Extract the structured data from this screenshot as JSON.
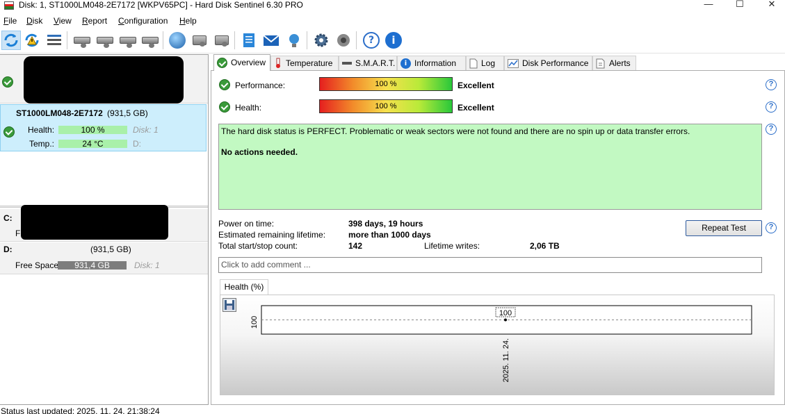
{
  "titlebar": {
    "title": "Disk: 1, ST1000LM048-2E7172 [WKPV65PC]  -  Hard Disk Sentinel 6.30 PRO",
    "minimize": "—",
    "maximize": "☐",
    "close": "✕"
  },
  "menu": [
    "File",
    "Disk",
    "View",
    "Report",
    "Configuration",
    "Help"
  ],
  "toolbar_icons": [
    "refresh-icon",
    "refresh-warning-icon",
    "disk-list-icon",
    "disk-icon",
    "disk-clock-icon",
    "disk-check-icon",
    "disk-search-icon",
    "globe-icon",
    "network-drive-icon",
    "remote-disk-icon",
    "notepad-icon",
    "mail-icon",
    "network-icon",
    "gear-icon",
    "speaker-icon",
    "help-icon",
    "info-icon"
  ],
  "disk": {
    "name": "ST1000LM048-2E7172",
    "size": "(931,5 GB)",
    "health_label": "Health:",
    "health_value": "100 %",
    "health_fill": 1.0,
    "disk_ref": "Disk: 1",
    "temp_label": "Temp.:",
    "temp_value": "24 °C",
    "drive_ref": "D:"
  },
  "partitions": [
    {
      "letter": "C:",
      "free_label": "Free"
    },
    {
      "letter": "D:",
      "size": "(931,5 GB)",
      "free_label": "Free Space",
      "free_value": "931,4 GB",
      "disk_ref": "Disk: 1"
    }
  ],
  "tabs": [
    "Overview",
    "Temperature",
    "S.M.A.R.T.",
    "Information",
    "Log",
    "Disk Performance",
    "Alerts"
  ],
  "overview": {
    "performance_label": "Performance:",
    "performance_value": "100 %",
    "performance_rating": "Excellent",
    "health_label": "Health:",
    "health_value": "100 %",
    "health_rating": "Excellent",
    "status_text": "The hard disk status is PERFECT. Problematic or weak sectors were not found and there are no spin up or data transfer errors.",
    "action_text": "No actions needed.",
    "power_on_label": "Power on time:",
    "power_on_value": "398 days, 19 hours",
    "lifetime_label": "Estimated remaining lifetime:",
    "lifetime_value": "more than 1000 days",
    "startstop_label": "Total start/stop count:",
    "startstop_value": "142",
    "writes_label": "Lifetime writes:",
    "writes_value": "2,06 TB",
    "repeat_button": "Repeat Test",
    "comment_placeholder": "Click to add comment ..."
  },
  "chart_tab": "Health (%)",
  "chart_data": {
    "type": "line",
    "x": [
      "2025. 11. 24."
    ],
    "series": [
      {
        "values": [
          100
        ]
      }
    ],
    "point_labels": [
      "100"
    ],
    "ytick_labels": [
      "100"
    ],
    "xtick_labels": [
      "2025. 11. 24."
    ],
    "grid": true
  },
  "status_bar": "Status last updated: 2025. 11. 24. 21:38:24",
  "colors": {
    "good_green": "#a9f0a9",
    "status_bg": "#c2f9c2",
    "selection": "#cdeefc",
    "accent_blue": "#2b6ec9"
  }
}
